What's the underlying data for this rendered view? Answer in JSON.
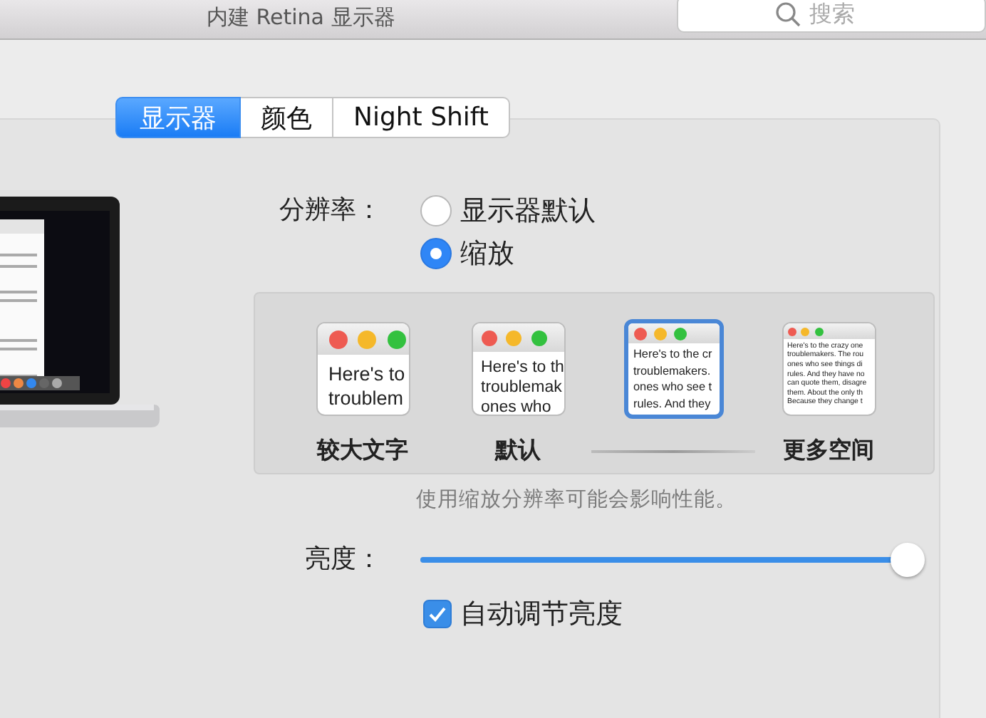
{
  "window": {
    "title": "内建 Retina 显示器"
  },
  "search": {
    "placeholder": "搜索"
  },
  "tabs": [
    {
      "label": "显示器",
      "selected": true
    },
    {
      "label": "颜色",
      "selected": false
    },
    {
      "label": "Night Shift",
      "selected": false
    }
  ],
  "resolution": {
    "label": "分辨率：",
    "options": [
      {
        "label": "显示器默认",
        "selected": false
      },
      {
        "label": "缩放",
        "selected": true
      }
    ]
  },
  "scaled_options": [
    {
      "preview_lines": [
        "Here's to",
        "troublem"
      ],
      "label": "较大文字",
      "selected": false
    },
    {
      "preview_lines": [
        "Here's to th",
        "troublemak",
        "ones who"
      ],
      "label": "默认",
      "selected": false
    },
    {
      "preview_lines": [
        "Here's to the cr",
        "troublemakers.",
        "ones who see t",
        "rules. And they"
      ],
      "selected": true
    },
    {
      "preview_lines": [
        "Here's to the crazy one",
        "troublemakers. The rou",
        "ones who see things di",
        "rules. And they have no",
        "can quote them, disagre",
        "them. About the only th",
        "Because they change t"
      ],
      "label": "更多空间",
      "selected": false
    }
  ],
  "note": "使用缩放分辨率可能会影响性能。",
  "brightness": {
    "label": "亮度：",
    "level": 0.98
  },
  "auto_brightness": {
    "label": "自动调节亮度",
    "checked": true
  }
}
